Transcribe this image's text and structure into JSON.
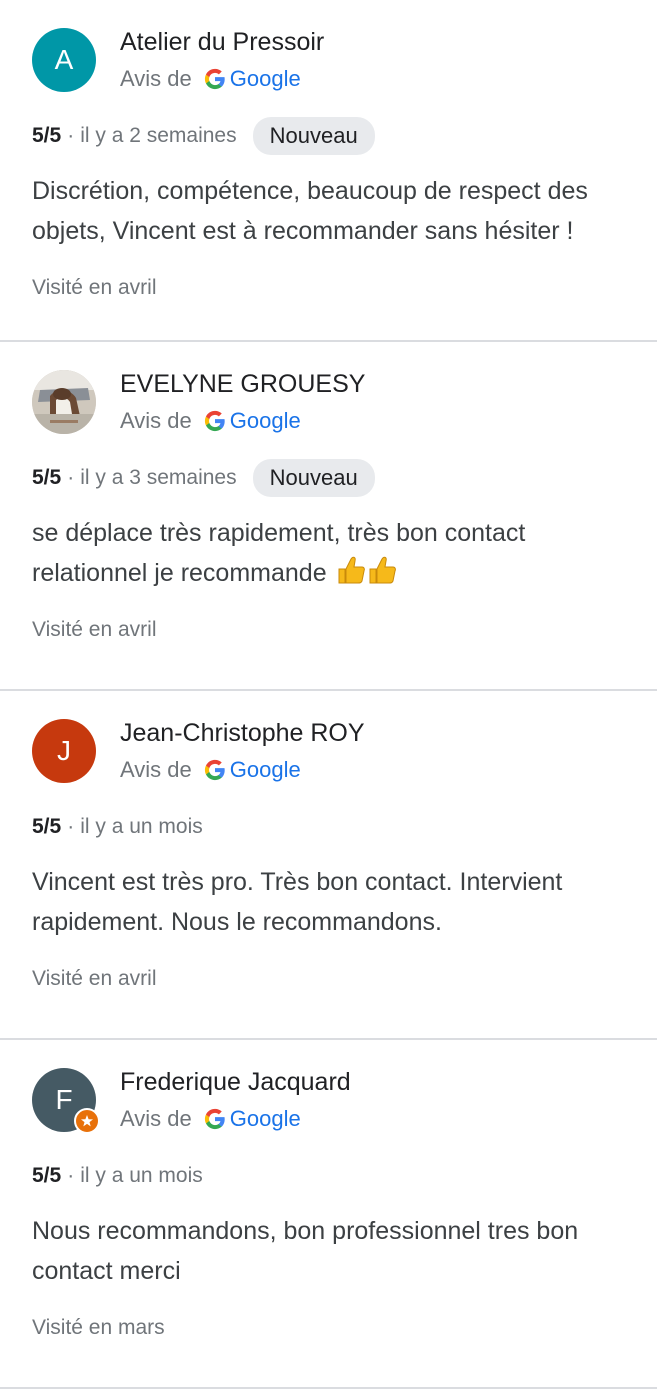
{
  "source_label": "Avis de",
  "source_brand": "Google",
  "separator": "·",
  "reviews": [
    {
      "avatar_letter": "A",
      "avatar_color": "#0097a7",
      "name": "Atelier du Pressoir",
      "rating": "5/5",
      "when": "il y a 2 semaines",
      "tag": "Nouveau",
      "text": "Discrétion, compétence, beaucoup de respect des objets, Vincent est à recommander sans hésiter !",
      "visited": "Visité en avril"
    },
    {
      "avatar_letter": "",
      "avatar_color": "#d7d4cf",
      "name": "EVELYNE GROUESY",
      "rating": "5/5",
      "when": "il y a 3 semaines",
      "tag": "Nouveau",
      "text": "se déplace très rapidement, très bon contact relationnel je recommande",
      "emoji": "👍👍",
      "visited": "Visité en avril"
    },
    {
      "avatar_letter": "J",
      "avatar_color": "#c6390e",
      "name": "Jean-Christophe ROY",
      "rating": "5/5",
      "when": "il y a un mois",
      "text": "Vincent est très pro. Très bon contact. Intervient rapidement. Nous le recommandons.",
      "visited": "Visité en avril"
    },
    {
      "avatar_letter": "F",
      "avatar_color": "#455a64",
      "name": "Frederique Jacquard",
      "rating": "5/5",
      "when": "il y a un mois",
      "text": "Nous recommandons, bon professionnel tres bon contact merci",
      "visited": "Visité en mars"
    }
  ],
  "icons": {
    "google_logo": "google-g-icon",
    "local_guide_badge": "local-guide-badge-icon",
    "thumbs_up": "thumbs-up-icon"
  }
}
